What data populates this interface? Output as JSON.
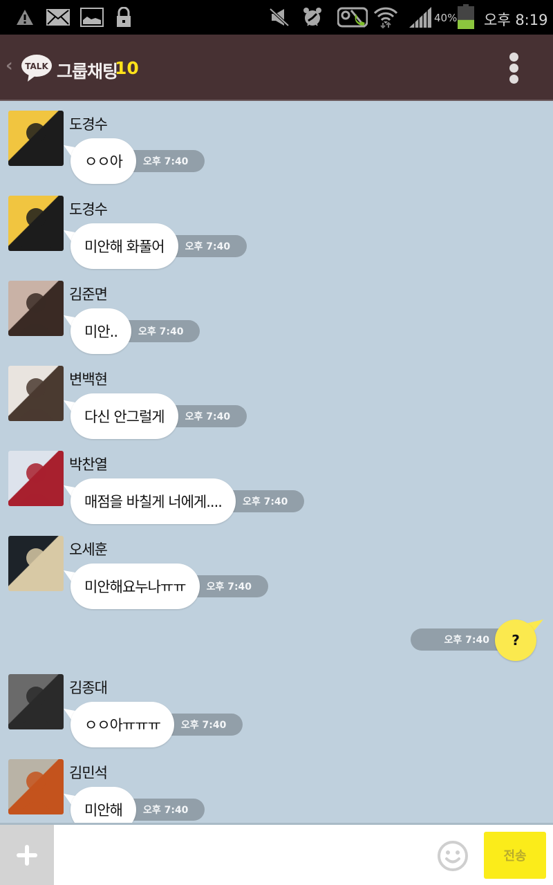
{
  "status_bar": {
    "left_icons": [
      "warning-icon",
      "mail-icon",
      "image-icon",
      "lock-icon"
    ],
    "right_icons": [
      "mute-icon",
      "alarm-icon",
      "call-blocked-icon",
      "wifi-icon",
      "signal-icon"
    ],
    "battery_percent_label": "40%",
    "battery_level": 0.4,
    "battery_color": "#8cc63e",
    "clock": "오후 8:19"
  },
  "app_bar": {
    "logo_text": "TALK",
    "title": "그룹채팅",
    "member_count": "10",
    "accent_color": "#ffe21a",
    "background_color": "#473133"
  },
  "chat": {
    "background_color": "#bfd0dd",
    "messages": [
      {
        "sender": "도경수",
        "text": "ㅇㅇ아",
        "time": "오후 7:40",
        "avatar_colors": [
          "#f1c540",
          "#1c1c1c"
        ]
      },
      {
        "sender": "도경수",
        "text": "미안해 화풀어",
        "time": "오후 7:40",
        "avatar_colors": [
          "#f1c540",
          "#1c1c1c"
        ]
      },
      {
        "sender": "김준면",
        "text": "미안..",
        "time": "오후 7:40",
        "avatar_colors": [
          "#c9b2a6",
          "#3a2a24"
        ]
      },
      {
        "sender": "변백현",
        "text": "다신 안그럴게",
        "time": "오후 7:40",
        "avatar_colors": [
          "#e9e4df",
          "#4a3a30"
        ]
      },
      {
        "sender": "박찬열",
        "text": "매점을 바칠게 너에게....",
        "time": "오후 7:40",
        "avatar_colors": [
          "#dde3ec",
          "#a8202e"
        ]
      },
      {
        "sender": "오세훈",
        "text": "미안해요누나ㅠㅠ",
        "time": "오후 7:40",
        "avatar_colors": [
          "#1d2329",
          "#d8c9a5"
        ]
      },
      {
        "sender": "김종대",
        "text": "ㅇㅇ아ㅠㅠㅠ",
        "time": "오후 7:40",
        "avatar_colors": [
          "#6a6a6a",
          "#2a2a2a"
        ]
      },
      {
        "sender": "김민석",
        "text": "미안해",
        "time": "오후 7:40",
        "avatar_colors": [
          "#b9b3a6",
          "#c4531d"
        ]
      }
    ],
    "my_message": {
      "text": "?",
      "time": "오후 7:40",
      "bubble_color": "#fbe94e"
    }
  },
  "input_bar": {
    "attach_label": "+",
    "input_value": "",
    "input_placeholder": "",
    "send_label": "전송",
    "send_color": "#fbec1a"
  }
}
